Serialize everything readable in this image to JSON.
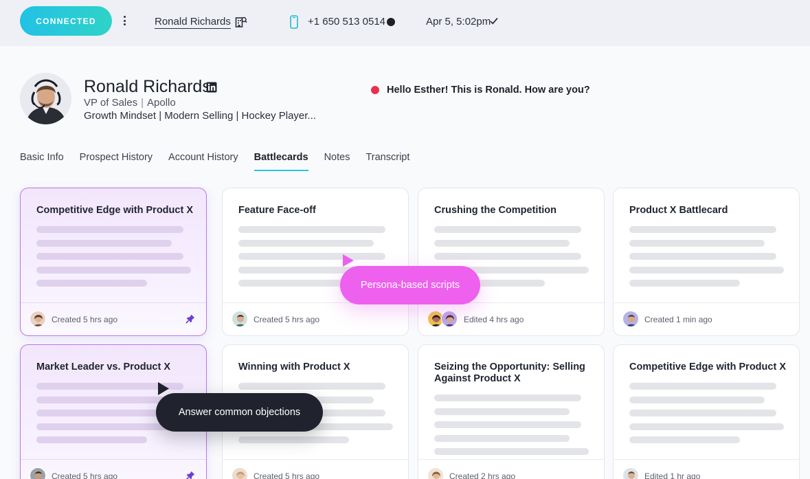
{
  "topbar": {
    "status": "CONNECTED",
    "contact_name": "Ronald Richards",
    "phone": "+1 650 513 0514",
    "timestamp": "Apr 5, 5:02pm"
  },
  "profile": {
    "name": "Ronald Richards",
    "role": "VP of Sales",
    "company": "Apollo",
    "tags": "Growth Mindset | Modern Selling | Hockey Player...",
    "live_message": "Hello Esther! This is Ronald. How are  you?"
  },
  "tabs": [
    "Basic Info",
    "Prospect History",
    "Account History",
    "Battlecards",
    "Notes",
    "Transcript"
  ],
  "active_tab": "Battlecards",
  "cards": [
    {
      "title": "Competitive Edge with Product X",
      "footer": "Created 5 hrs ago",
      "pinned": true,
      "selected": true
    },
    {
      "title": "Feature Face-off",
      "footer": "Created 5 hrs ago",
      "pinned": false,
      "selected": false
    },
    {
      "title": "Crushing the Competition",
      "footer": "Edited 4 hrs ago",
      "pinned": false,
      "selected": false
    },
    {
      "title": "Product X Battlecard",
      "footer": "Created 1 min ago",
      "pinned": false,
      "selected": false
    },
    {
      "title": "Market Leader vs. Product X",
      "footer": "Created 5 hrs ago",
      "pinned": true,
      "selected": true
    },
    {
      "title": "Winning with Product X",
      "footer": "Created 5 hrs ago",
      "pinned": false,
      "selected": false
    },
    {
      "title": "Seizing the Opportunity: Selling Against Product X",
      "footer": "Created 2 hrs ago",
      "pinned": false,
      "selected": false
    },
    {
      "title": "Competitive Edge with Product X",
      "footer": "Edited 1 hr ago",
      "pinned": false,
      "selected": false
    }
  ],
  "tooltips": {
    "pink": "Persona-based scripts",
    "dark": "Answer common objections"
  },
  "colors": {
    "connected_gradient_start": "#22c1e6",
    "connected_gradient_end": "#2fd3c6",
    "active_tab_underline": "#2ac5d8",
    "live_dot": "#e8304d",
    "selected_card_border": "#b777e6",
    "pink_tooltip": "#ee60ee",
    "dark_tooltip": "#20232d",
    "pin": "#6b3fd0"
  }
}
